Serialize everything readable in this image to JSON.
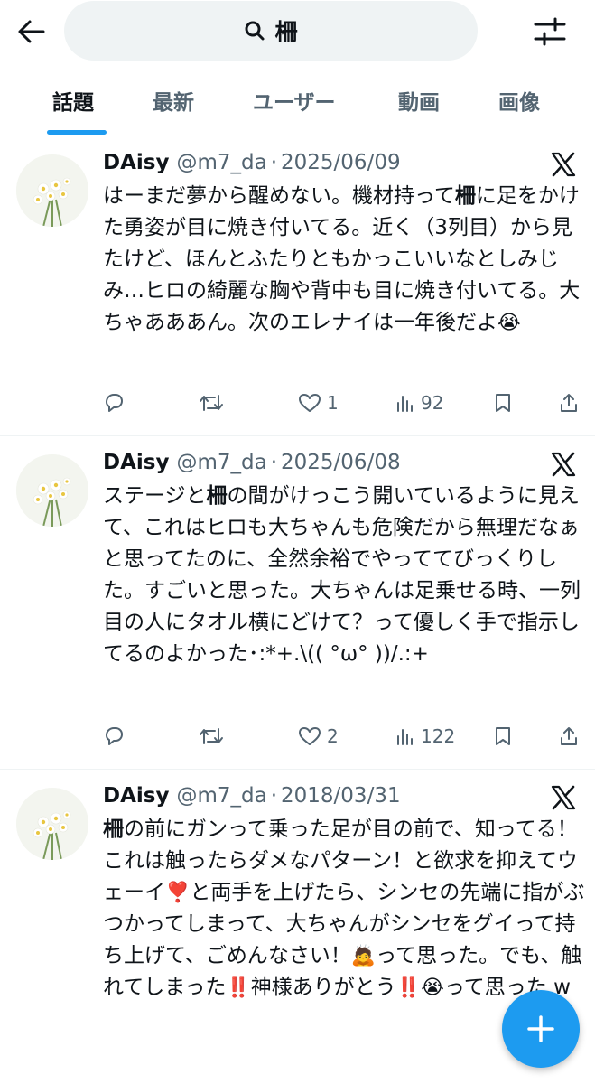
{
  "search": {
    "query": "柵"
  },
  "tabs": [
    {
      "label": "話題",
      "active": true
    },
    {
      "label": "最新"
    },
    {
      "label": "ユーザー"
    },
    {
      "label": "動画"
    },
    {
      "label": "画像"
    }
  ],
  "tweets": [
    {
      "name": "DAisy",
      "handle": "@m7_da",
      "sep": "·",
      "date": "2025/06/09",
      "text_parts": [
        "はーまだ夢から醒めない。機材持って",
        "柵",
        "に足をかけた勇姿が目に焼き付いてる。近く（3列目）から見たけど、ほんとふたりともかっこいいなとしみじみ…ヒロの綺麗な胸や背中も目に焼き付いてる。大ちゃあああん。次のエレナイは一年後だよ",
        "😭"
      ],
      "replies": "",
      "retweets": "",
      "likes": "1",
      "views": "92"
    },
    {
      "name": "DAisy",
      "handle": "@m7_da",
      "sep": "·",
      "date": "2025/06/08",
      "text_parts": [
        "ステージと",
        "柵",
        "の間がけっこう開いているように見えて、これはヒロも大ちゃんも危険だから無理だなぁと思ってたのに、全然余裕でやっててびっくりした。すごいと思った。大ちゃんは足乗せる時、一列目の人にタオル横にどけて？って優しく手で指示してるのよかった･:*+.\\(( °ω° ))/.:+"
      ],
      "replies": "",
      "retweets": "",
      "likes": "2",
      "views": "122"
    },
    {
      "name": "DAisy",
      "handle": "@m7_da",
      "sep": "·",
      "date": "2018/03/31",
      "text_parts": [
        "柵",
        "の前にガンって乗った足が目の前で、知ってる！これは触ったらダメなパターン！と欲求を抑えてウェーイ",
        "❣️",
        "と両手を上げたら、シンセの先端に指がぶつかってしまって、大ちゃんがシンセをグイって持ち上げて、ごめんなさい！",
        "🙇",
        "って思った。でも、触れてしまった",
        "‼️",
        "神様ありがとう",
        "‼️",
        "😭",
        "って思った w"
      ],
      "replies": "",
      "retweets": "",
      "likes": "",
      "views": ""
    }
  ],
  "colors": {
    "accent": "#1d9bf0",
    "text": "#0f1419",
    "muted": "#536471",
    "search_bg": "#eff3f4"
  },
  "icons": [
    "back-arrow-icon",
    "search-icon",
    "filter-sliders-icon",
    "x-logo-icon",
    "reply-icon",
    "retweet-icon",
    "like-icon",
    "views-icon",
    "bookmark-icon",
    "share-icon",
    "compose-plus-icon"
  ]
}
